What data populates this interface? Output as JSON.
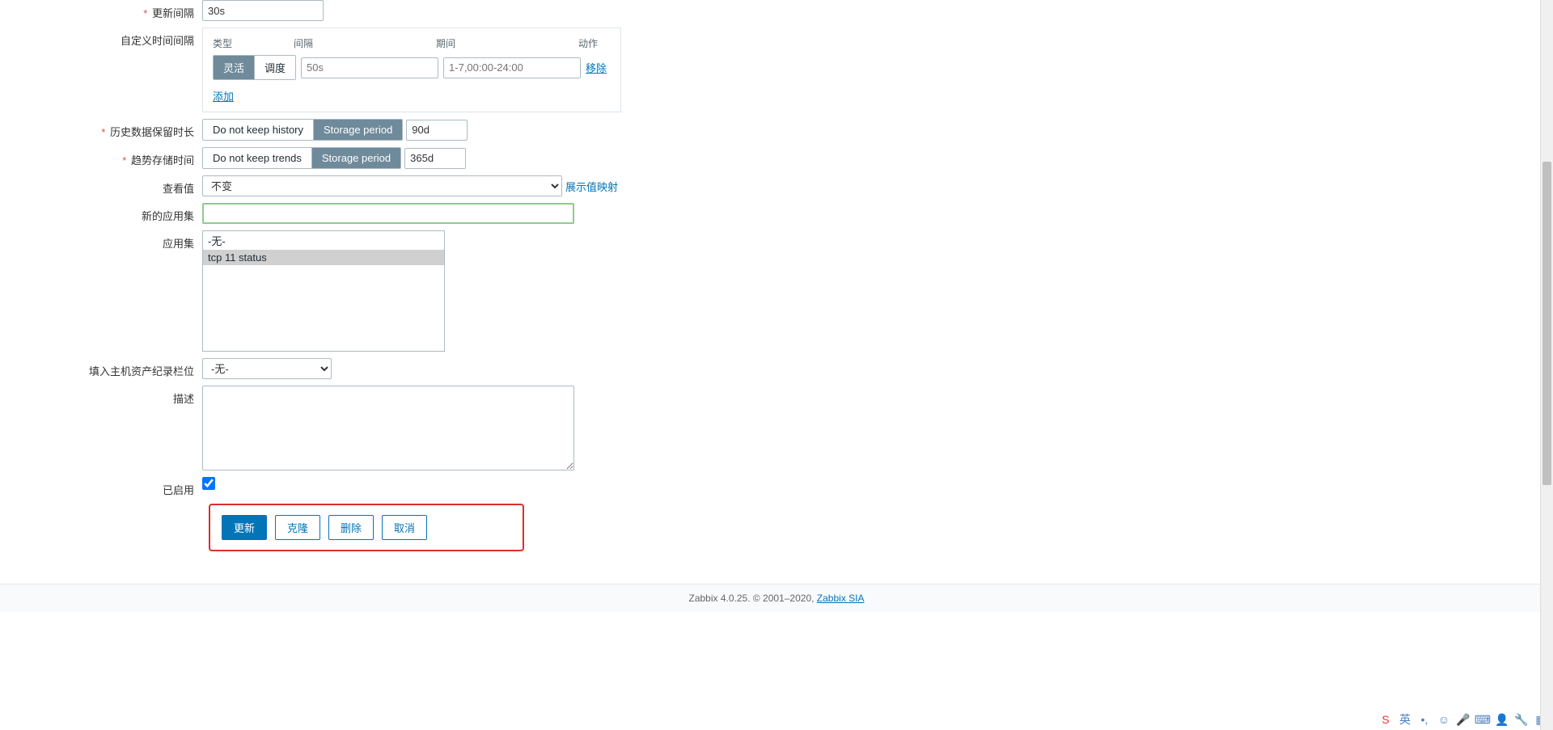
{
  "labels": {
    "update_interval": "更新间隔",
    "custom_intervals": "自定义时间间隔",
    "history_keep": "历史数据保留时长",
    "trend_keep": "趋势存储时间",
    "view_value": "查看值",
    "new_app": "新的应用集",
    "apps": "应用集",
    "inventory": "填入主机资产纪录栏位",
    "description": "描述",
    "enabled": "已启用"
  },
  "interval_headers": {
    "type": "类型",
    "interval": "间隔",
    "period": "期间",
    "action": "动作"
  },
  "interval_type": {
    "flexible": "灵活",
    "scheduling": "调度"
  },
  "placeholders": {
    "interval_val": "50s",
    "period_val": "1-7,00:00-24:00"
  },
  "links": {
    "remove": "移除",
    "add": "添加",
    "show_value_map": "展示值映射"
  },
  "history": {
    "no_keep": "Do not keep history",
    "storage": "Storage period",
    "value": "90d"
  },
  "trends": {
    "no_keep": "Do not keep trends",
    "storage": "Storage period",
    "value": "365d"
  },
  "view_value_options": {
    "selected": "不变"
  },
  "update_interval_value": "30s",
  "new_app_value": "",
  "apps_options": {
    "none": "-无-",
    "tcp": "tcp 11 status"
  },
  "inventory_options": {
    "selected": "-无-"
  },
  "buttons": {
    "update": "更新",
    "clone": "克隆",
    "delete": "删除",
    "cancel": "取消"
  },
  "footer": {
    "text": "Zabbix 4.0.25. © 2001–2020, ",
    "link": "Zabbix SIA"
  },
  "tray_lang": "英"
}
